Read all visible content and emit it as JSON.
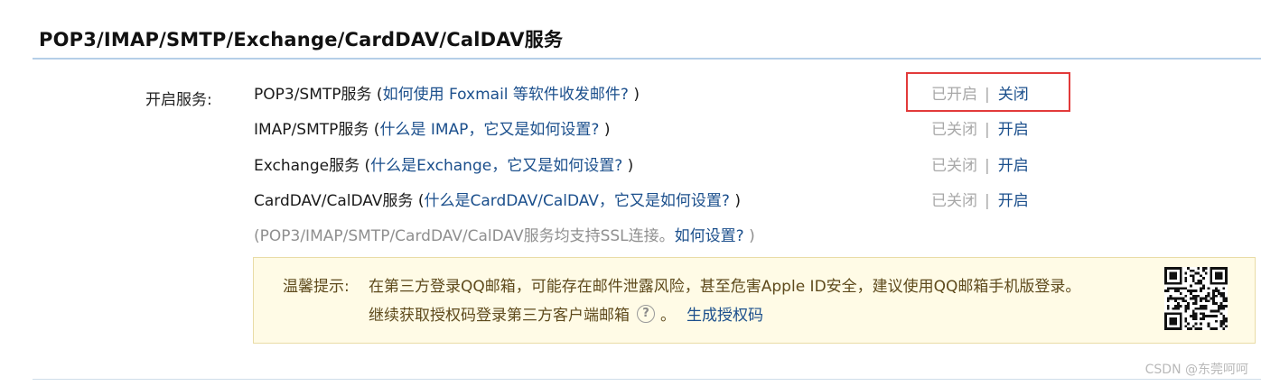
{
  "section": {
    "title": "POP3/IMAP/SMTP/Exchange/CardDAV/CalDAV服务"
  },
  "services": {
    "label": "开启服务:",
    "rows": [
      {
        "name": "POP3/SMTP服务",
        "open": " (",
        "link": "如何使用 Foxmail 等软件收发邮件?",
        "close": " )",
        "state": "已开启",
        "sep": "|",
        "action": "关闭"
      },
      {
        "name": "IMAP/SMTP服务",
        "open": " (",
        "link": "什么是 IMAP，它又是如何设置?",
        "close": " )",
        "state": "已关闭",
        "sep": "|",
        "action": "开启"
      },
      {
        "name": "Exchange服务",
        "open": " (",
        "link": "什么是Exchange，它又是如何设置?",
        "close": " )",
        "state": "已关闭",
        "sep": "|",
        "action": "开启"
      },
      {
        "name": "CardDAV/CalDAV服务",
        "open": " (",
        "link": "什么是CardDAV/CalDAV，它又是如何设置?",
        "close": " )",
        "state": "已关闭",
        "sep": "|",
        "action": "开启"
      }
    ],
    "ssl_note": "(POP3/IMAP/SMTP/CardDAV/CalDAV服务均支持SSL连接。",
    "ssl_link": "如何设置?",
    "ssl_close": " )"
  },
  "tip": {
    "label": "温馨提示:",
    "line1": "在第三方登录QQ邮箱，可能存在邮件泄露风险，甚至危害Apple ID安全，建议使用QQ邮箱手机版登录。",
    "line2": "继续获取授权码登录第三方客户端邮箱",
    "help_glyph": "?",
    "period": "。",
    "generate_link": "生成授权码",
    "qr_icon": "qr-code-icon"
  },
  "watermark": "CSDN @东莞呵呵",
  "colors": {
    "link": "#1b4f8c",
    "highlight": "#e23a3a",
    "tip_bg": "#fffbe6"
  }
}
